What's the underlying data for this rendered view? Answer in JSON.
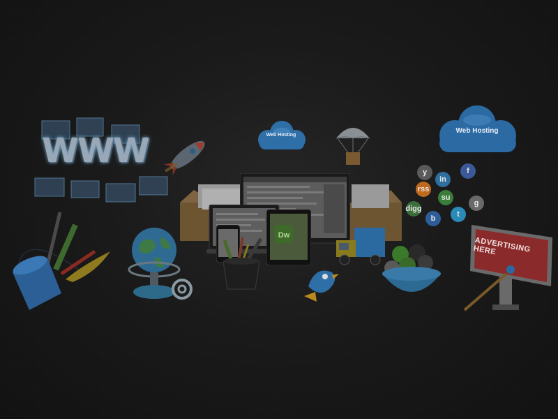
{
  "banner": {
    "www": "WWW",
    "cloud_left_label": "Web Hosting",
    "cloud_right_label": "Web Hosting",
    "billboard_label": "ADVERTISING HERE",
    "dw_label": "Dw",
    "social_icons": [
      "f",
      "in",
      "su",
      "rss",
      "g",
      "digg",
      "t",
      "b",
      "y"
    ],
    "colors": {
      "background": "#161616",
      "cloud": "#2f6fa8",
      "www_glow": "#6fb0d8",
      "billboard": "#8b2a2a",
      "globe": "#2f6a93"
    }
  }
}
